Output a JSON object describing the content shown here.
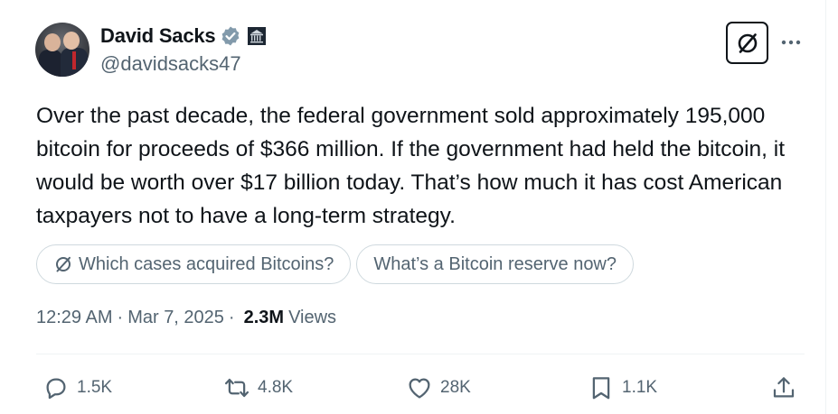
{
  "author": {
    "name": "David Sacks",
    "handle": "@davidsacks47",
    "verified": true,
    "verified_color": "#829aab"
  },
  "tweet": {
    "text": "Over the past decade, the federal government sold approximately 195,000 bitcoin for proceeds of $366 million. If the government had held the bitcoin, it would be worth over $17 billion today. That’s how much it has cost American taxpayers not to have a long-term strategy."
  },
  "suggestions": [
    {
      "label": "Which cases acquired Bitcoins?",
      "icon": "grok-icon"
    },
    {
      "label": "What’s a Bitcoin reserve now?"
    }
  ],
  "meta": {
    "time": "12:29 AM",
    "separator": "·",
    "date": "Mar 7, 2025",
    "views_count": "2.3M",
    "views_label": "Views"
  },
  "actions": {
    "replies": "1.5K",
    "reposts": "4.8K",
    "likes": "28K",
    "bookmarks": "1.1K"
  },
  "icons": [
    "verified-badge-icon",
    "government-affiliation-icon",
    "grok-icon",
    "more-icon",
    "reply-icon",
    "repost-icon",
    "like-icon",
    "bookmark-icon",
    "share-icon"
  ]
}
